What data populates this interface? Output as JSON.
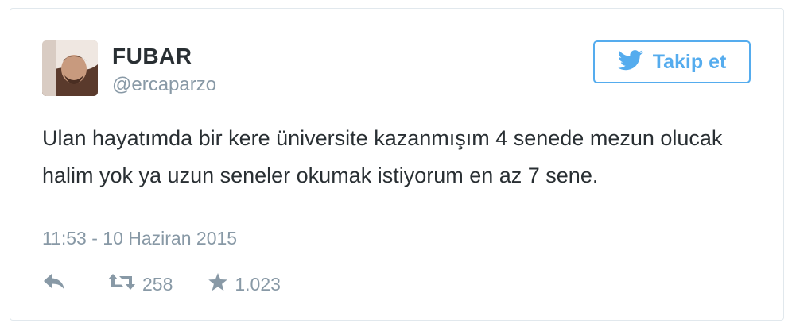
{
  "tweet": {
    "user": {
      "display_name": "FUBAR",
      "handle": "@ercaparzo"
    },
    "follow_button": {
      "label": "Takip et",
      "icon": "twitter-bird-icon",
      "color": "#55acee"
    },
    "text": "Ulan hayatımda bir kere üniversite kazanmışım 4 senede mezun olucak halim yok ya uzun seneler okumak istiyorum en az 7 sene.",
    "timestamp": "11:53 - 10 Haziran 2015",
    "actions": {
      "reply": {
        "icon": "reply-icon"
      },
      "retweet": {
        "icon": "retweet-icon",
        "count": "258"
      },
      "favorite": {
        "icon": "star-icon",
        "count": "1.023"
      }
    }
  }
}
